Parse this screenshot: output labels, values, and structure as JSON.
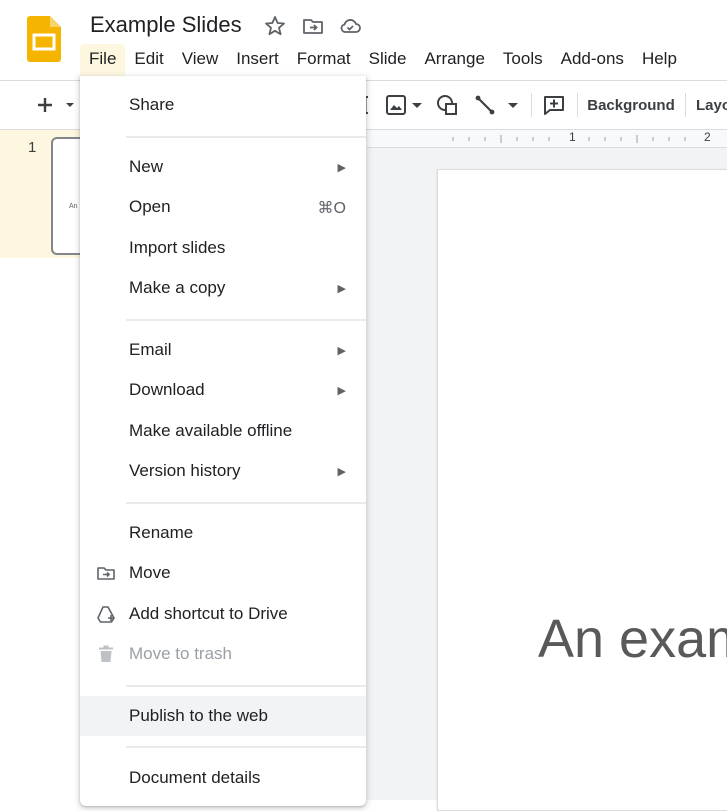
{
  "app": {
    "title": "Example Slides"
  },
  "menubar": {
    "items": [
      "File",
      "Edit",
      "View",
      "Insert",
      "Format",
      "Slide",
      "Arrange",
      "Tools",
      "Add-ons",
      "Help"
    ],
    "active": "File"
  },
  "toolbar": {
    "background_label": "Background",
    "layout_label": "Layo"
  },
  "ruler": {
    "labels": [
      "1",
      "2"
    ]
  },
  "filmstrip": {
    "slide_number": "1",
    "thumb_text": "An"
  },
  "canvas": {
    "text": "An exam"
  },
  "file_menu": {
    "share": "Share",
    "new": "New",
    "open": "Open",
    "open_shortcut": "⌘O",
    "import_slides": "Import slides",
    "make_copy": "Make a copy",
    "email": "Email",
    "download": "Download",
    "offline": "Make available offline",
    "version_history": "Version history",
    "rename": "Rename",
    "move": "Move",
    "add_shortcut": "Add shortcut to Drive",
    "trash": "Move to trash",
    "publish": "Publish to the web",
    "details": "Document details"
  },
  "icons": {
    "logo": "slides-logo-icon",
    "star": "star-icon",
    "move_folder": "move-folder-icon",
    "cloud": "cloud-icon",
    "submenu": "submenu-arrow-icon",
    "shortcut": "add-shortcut-icon",
    "trash": "trash-icon"
  },
  "colors": {
    "brand": "#f4b400",
    "active_menu_bg": "#fef7e0",
    "highlight_bg": "#f1f3f4",
    "disabled_text": "#9aa0a6"
  }
}
